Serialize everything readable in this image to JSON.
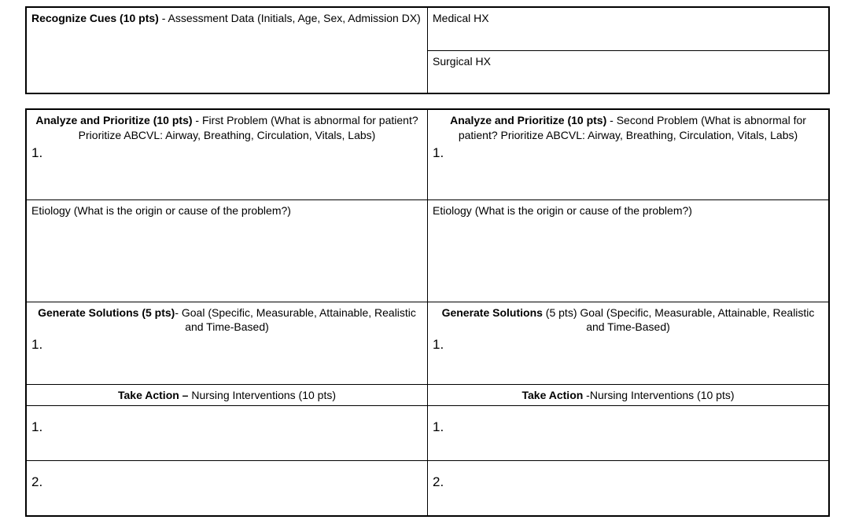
{
  "top": {
    "recognize_cues": {
      "title": "Recognize Cues (10 pts)",
      "desc": " - Assessment Data (Initials, Age, Sex, Admission DX)"
    },
    "medical_hx": "Medical HX",
    "surgical_hx": "Surgical HX"
  },
  "left": {
    "analyze": {
      "title": "Analyze and Prioritize (10 pts)",
      "desc": " - First Problem (What is abnormal for patient? Prioritize ABCVL: Airway, Breathing, Circulation, Vitals, Labs)",
      "num": "1."
    },
    "etiology": "Etiology (What is the origin or cause of the problem?)",
    "gensol": {
      "title": "Generate Solutions (5 pts)",
      "desc": "- Goal (Specific, Measurable, Attainable, Realistic and Time-Based)",
      "num": "1."
    },
    "takeaction": {
      "title": "Take Action –",
      "desc": " Nursing Interventions (10 pts)",
      "n1": "1.",
      "n2": "2."
    }
  },
  "right": {
    "analyze": {
      "title": "Analyze and Prioritize (10 pts)",
      "desc": " - Second Problem (What is abnormal for patient? Prioritize ABCVL: Airway, Breathing, Circulation, Vitals, Labs)",
      "num": "1."
    },
    "etiology": "Etiology (What is the origin or cause of the problem?)",
    "gensol": {
      "title": "Generate Solutions",
      "desc": " (5 pts) Goal (Specific, Measurable, Attainable, Realistic and Time-Based)",
      "num": "1."
    },
    "takeaction": {
      "title": "Take Action",
      "desc": " -Nursing Interventions (10 pts)",
      "n1": "1.",
      "n2": "2."
    }
  }
}
